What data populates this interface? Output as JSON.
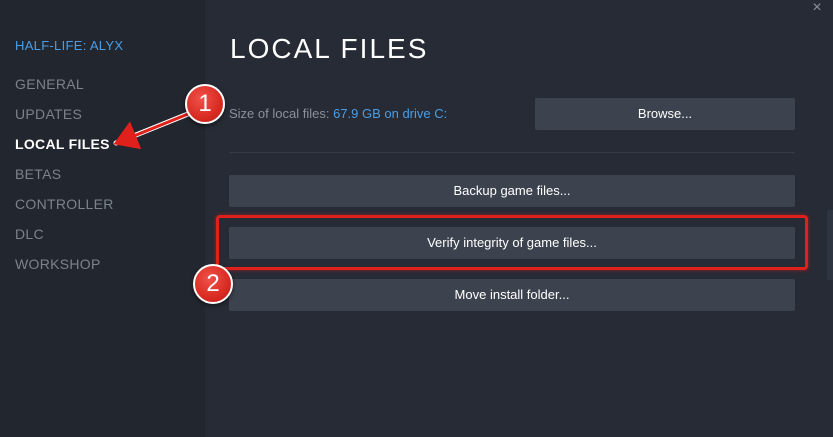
{
  "sidebar": {
    "game_title": "HALF-LIFE: ALYX",
    "items": [
      {
        "label": "GENERAL"
      },
      {
        "label": "UPDATES"
      },
      {
        "label": "LOCAL FILES"
      },
      {
        "label": "BETAS"
      },
      {
        "label": "CONTROLLER"
      },
      {
        "label": "DLC"
      },
      {
        "label": "WORKSHOP"
      }
    ],
    "active_index": 2
  },
  "main": {
    "title": "LOCAL FILES",
    "size_label": "Size of local files:",
    "size_value": "67.9 GB on drive C:",
    "browse_label": "Browse...",
    "backup_label": "Backup game files...",
    "verify_label": "Verify integrity of game files...",
    "move_label": "Move install folder..."
  },
  "window": {
    "close_glyph": "×"
  },
  "annotations": {
    "step1": "1",
    "step2": "2"
  },
  "colors": {
    "accent_blue": "#4a9ee6",
    "annotation_red": "#e0201a",
    "button_bg": "#3d434e",
    "sidebar_bg": "#22262e",
    "main_bg": "#262b35"
  }
}
